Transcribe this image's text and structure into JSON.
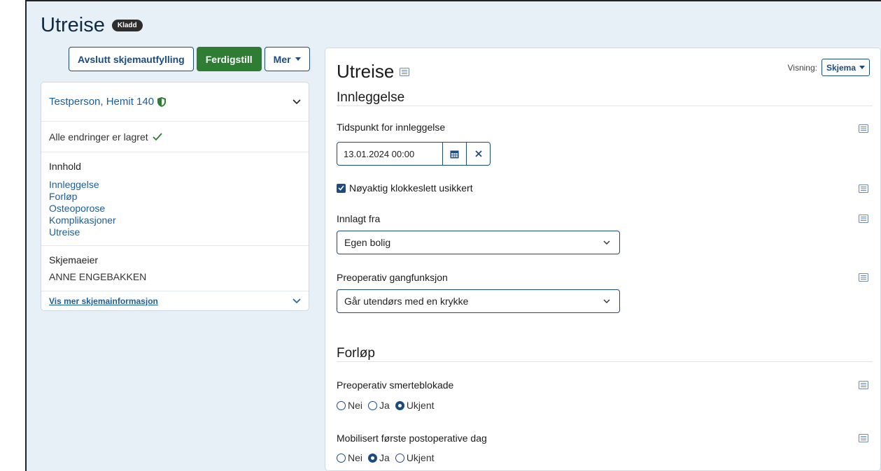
{
  "page": {
    "title": "Utreise",
    "badge": "Kladd"
  },
  "toolbar": {
    "exit_label": "Avslutt skjemautfylling",
    "finish_label": "Ferdigstill",
    "more_label": "Mer"
  },
  "sidebar": {
    "person_name": "Testperson, Hemit 140",
    "saved_status": "Alle endringer er lagret",
    "content_heading": "Innhold",
    "content_links": [
      "Innleggelse",
      "Forløp",
      "Osteoporose",
      "Komplikasjoner",
      "Utreise"
    ],
    "owner_heading": "Skjemaeier",
    "owner_name": "ANNE ENGEBAKKEN",
    "more_info_link": "Vis mer skjemainformasjon"
  },
  "form": {
    "title": "Utreise",
    "view_label": "Visning:",
    "view_value": "Skjema",
    "sections": {
      "innleggelse": "Innleggelse",
      "forlop": "Forløp"
    },
    "fields": {
      "admission_time_label": "Tidspunkt for innleggelse",
      "admission_time_value": "13.01.2024 00:00",
      "uncertain_time_label": "Nøyaktig klokkeslett usikkert",
      "uncertain_time_checked": true,
      "admitted_from_label": "Innlagt fra",
      "admitted_from_value": "Egen bolig",
      "preop_walking_label": "Preoperativ gangfunksjon",
      "preop_walking_value": "Går utendørs med en krykke",
      "pain_block_label": "Preoperativ smerteblokade",
      "mobilized_label": "Mobilisert første postoperative dag"
    },
    "radio_options": [
      "Nei",
      "Ja",
      "Ukjent"
    ],
    "pain_block_selected": "Ukjent",
    "mobilized_selected": "Ja"
  },
  "colors": {
    "primary": "#1c4b7e",
    "success": "#2e7d32",
    "link": "#1a5fa0",
    "background": "#e8f0f7",
    "annotation_arrow": "#e41b1b"
  },
  "icons": [
    "shield-icon",
    "chevron-down-icon",
    "check-icon",
    "list-icon",
    "calendar-icon",
    "close-icon"
  ]
}
